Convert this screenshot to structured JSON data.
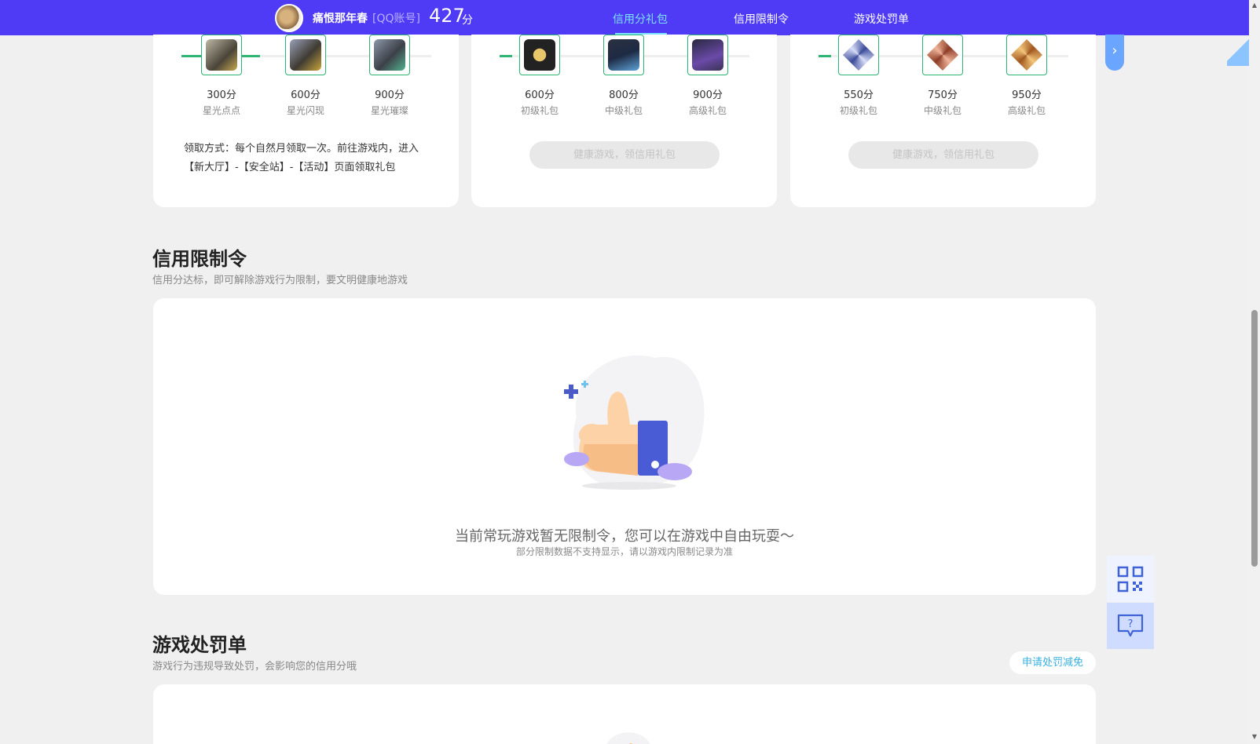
{
  "header": {
    "username": "痛恨那年春",
    "account_type": "[QQ账号]",
    "score": "427",
    "score_unit": "分",
    "nav": [
      {
        "label": "信用分礼包",
        "active": true
      },
      {
        "label": "信用限制令",
        "active": false
      },
      {
        "label": "游戏处罚单",
        "active": false
      }
    ]
  },
  "reward_cards": [
    {
      "items": [
        {
          "points": "300分",
          "name": "星光点点"
        },
        {
          "points": "600分",
          "name": "星光闪现"
        },
        {
          "points": "900分",
          "name": "星光璀璨"
        }
      ],
      "claim_text": "领取方式：每个自然月领取一次。前往游戏内，进入【新大厅】-【安全站】-【活动】页面领取礼包"
    },
    {
      "items": [
        {
          "points": "600分",
          "name": "初级礼包"
        },
        {
          "points": "800分",
          "name": "中级礼包"
        },
        {
          "points": "900分",
          "name": "高级礼包"
        }
      ],
      "button_label": "健康游戏，领信用礼包"
    },
    {
      "items": [
        {
          "points": "550分",
          "name": "初级礼包"
        },
        {
          "points": "750分",
          "name": "中级礼包"
        },
        {
          "points": "950分",
          "name": "高级礼包"
        }
      ],
      "button_label": "健康游戏，领信用礼包"
    }
  ],
  "restriction": {
    "title": "信用限制令",
    "subtitle": "信用分达标，即可解除游戏行为限制，要文明健康地游戏",
    "empty_message": "当前常玩游戏暂无限制令，您可以在游戏中自由玩耍～",
    "empty_note": "部分限制数据不支持显示，请以游戏内限制记录为准"
  },
  "penalty": {
    "title": "游戏处罚单",
    "subtitle": "游戏行为违规导致处罚，会影响您的信用分哦",
    "appeal_button": "申请处罚减免"
  },
  "icons": {
    "next": "chevron-right-icon",
    "qr": "qr-code-icon",
    "help": "help-chat-icon"
  },
  "colors": {
    "header_bg": "#4f3bf5",
    "active_nav": "#7ee2ff",
    "progress": "#2cb573",
    "link": "#38b0e0"
  }
}
